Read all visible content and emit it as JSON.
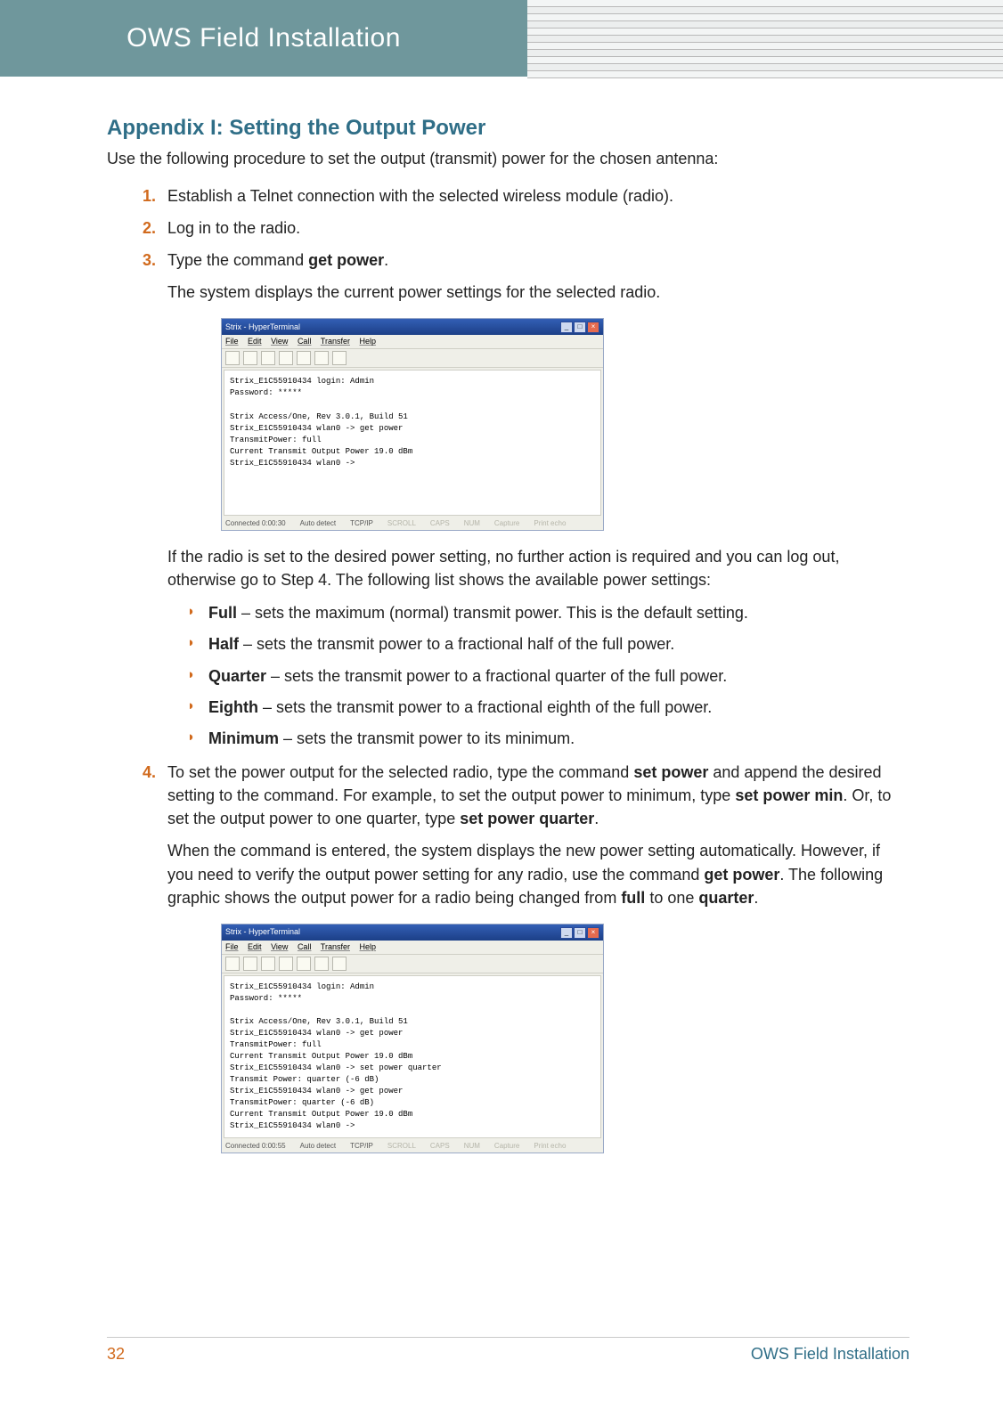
{
  "header": {
    "title": "OWS Field Installation"
  },
  "appendix": {
    "heading": "Appendix I: Setting the Output Power",
    "lead": "Use the following procedure to set the output (transmit) power for the chosen antenna:"
  },
  "steps": {
    "s1": "Establish a Telnet connection with the selected wireless module (radio).",
    "s2": "Log in to the radio.",
    "s3_pre": "Type the command ",
    "s3_cmd": "get power",
    "s3_post": ".",
    "s3_sub1": "The system displays the current power settings for the selected radio.",
    "s3_sub2": "If the radio is set to the desired power setting, no further action is required and you can log out, otherwise go to Step 4. The following list shows the available power settings:",
    "s4_a_pre": "To set the power output for the selected radio, type the command ",
    "s4_a_cmd1": "set power",
    "s4_a_mid1": " and append the desired setting to the command. For example, to set the output power to minimum, type ",
    "s4_a_cmd2": "set power min",
    "s4_a_mid2": ". Or, to set the output power to one quarter, type ",
    "s4_a_cmd3": "set power quarter",
    "s4_a_post": ".",
    "s4_b_pre": "When the command is entered, the system displays the new power setting automatically. However, if you need to verify the output power setting for any radio, use the command ",
    "s4_b_cmd": "get power",
    "s4_b_mid": ". The following graphic shows the output power for a radio being changed from ",
    "s4_b_w1": "full",
    "s4_b_mid2": " to one ",
    "s4_b_w2": "quarter",
    "s4_b_post": "."
  },
  "bullets": {
    "b1_name": "Full",
    "b1_desc": " – sets the maximum (normal) transmit power. This is the default setting.",
    "b2_name": "Half",
    "b2_desc": " – sets the transmit power to a fractional half of the full power.",
    "b3_name": "Quarter",
    "b3_desc": " – sets the transmit power to a fractional quarter of the full power.",
    "b4_name": "Eighth",
    "b4_desc": " – sets the transmit power to a fractional eighth of the full power.",
    "b5_name": "Minimum",
    "b5_desc": " – sets the transmit power to its minimum."
  },
  "terminal": {
    "title": "Strix - HyperTerminal",
    "menu_file": "File",
    "menu_edit": "Edit",
    "menu_view": "View",
    "menu_call": "Call",
    "menu_transfer": "Transfer",
    "menu_help": "Help",
    "body1": "Strix_E1C55910434 login: Admin\nPassword: *****\n\nStrix Access/One, Rev 3.0.1, Build 51\nStrix_E1C55910434 wlan0 -> get power\nTransmitPower: full\nCurrent Transmit Output Power 19.0 dBm\nStrix_E1C55910434 wlan0 ->",
    "body2": "Strix_E1C55910434 login: Admin\nPassword: *****\n\nStrix Access/One, Rev 3.0.1, Build 51\nStrix_E1C55910434 wlan0 -> get power\nTransmitPower: full\nCurrent Transmit Output Power 19.0 dBm\nStrix_E1C55910434 wlan0 -> set power quarter\nTransmit Power: quarter (-6 dB)\nStrix_E1C55910434 wlan0 -> get power\nTransmitPower: quarter (-6 dB)\nCurrent Transmit Output Power 19.0 dBm\nStrix_E1C55910434 wlan0 ->",
    "status_conn1": "Connected 0:00:30",
    "status_conn2": "Connected 0:00:55",
    "status_auto": "Auto detect",
    "status_proto": "TCP/IP",
    "status_scroll": "SCROLL",
    "status_caps": "CAPS",
    "status_num": "NUM",
    "status_capture": "Capture",
    "status_print": "Print echo"
  },
  "footer": {
    "pagenum": "32",
    "doctitle": "OWS Field Installation"
  }
}
